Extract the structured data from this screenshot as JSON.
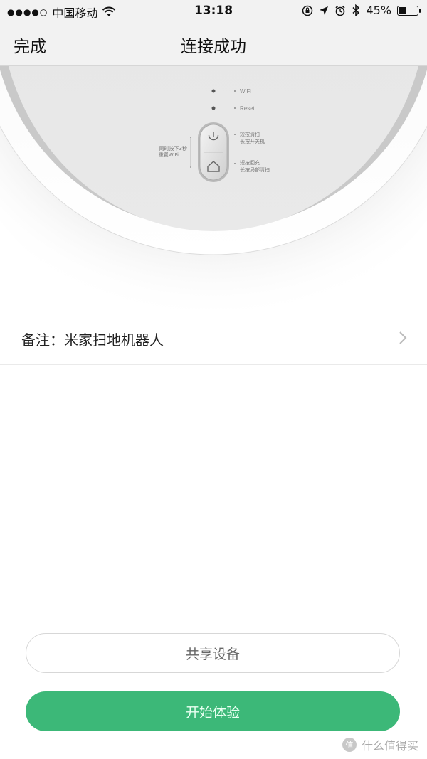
{
  "status_bar": {
    "carrier": "中国移动",
    "signal_dots": "●●●●○",
    "time": "13:18",
    "battery_percent_text": "45%",
    "battery_level": 0.45
  },
  "nav": {
    "done_label": "完成",
    "title": "连接成功"
  },
  "device_panel": {
    "wifi_label": "WiFi",
    "reset_label": "Reset",
    "reset_hint_line1": "同时按下3秒",
    "reset_hint_line2": "重置WiFi",
    "power_hint_line1": "短按清扫",
    "power_hint_line2": "长按开关机",
    "home_hint_line1": "短按回充",
    "home_hint_line2": "长按局部清扫"
  },
  "note": {
    "label": "备注：米家扫地机器人"
  },
  "buttons": {
    "share_label": "共享设备",
    "start_label": "开始体验"
  },
  "watermark": {
    "text": "什么值得买"
  },
  "colors": {
    "primary_green": "#3cb878",
    "nav_bg": "#f2f2f2"
  }
}
